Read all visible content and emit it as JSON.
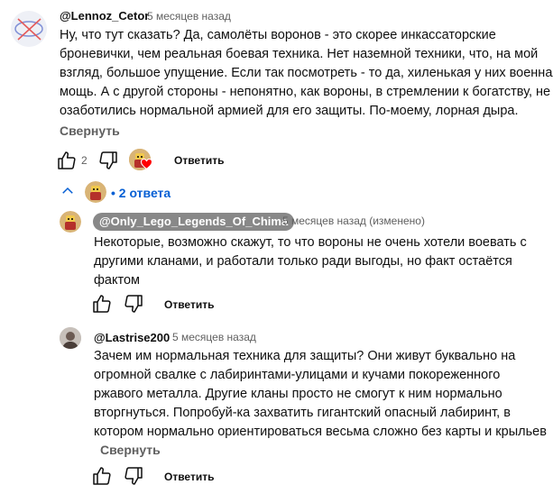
{
  "comments": [
    {
      "author": "@Lennoz_Cetor",
      "time": "5 месяцев назад",
      "lines": [
        "Ну, что тут сказать? Да, самолёты воронов - это скорее инкассаторские",
        "броневички, чем реальная боевая техника. Нет наземной техники, что, на мой",
        "взгляд, большое упущение. Если так посмотреть - то да, хиленькая у них военная",
        "мощь. А с другой стороны - непонятно, как вороны, в стремлении к богатству, не",
        "озаботились нормальной армией для его защиты. По-моему, лорная дыра."
      ],
      "collapse_label": "Свернуть",
      "like_count": "2",
      "reply_label": "Ответить",
      "replies_toggle": "• 2 ответа"
    }
  ],
  "replies": [
    {
      "author": "@Only_Lego_Legends_Of_Chima",
      "time": "5 месяцев назад (изменено)",
      "lines": [
        "Некоторые, возможно скажут, то что вороны не очень хотели воевать с",
        "другими кланами, и работали только ради выгоды, но факт остаётся",
        "фактом"
      ],
      "reply_label": "Ответить"
    },
    {
      "author": "@Lastrise200",
      "time": "5 месяцев назад",
      "lines": [
        "Зачем им нормальная техника для защиты? Они живут буквально на",
        "огромной свалке с лабиринтами-улицами и кучами покореженного",
        "ржавого металла. Другие кланы просто не смогут к ним нормально",
        "вторгнуться. Попробуй-ка захватить гигантский опасный лабиринт, в",
        "котором нормально ориентироваться весьма сложно без карты и крыльев"
      ],
      "collapse_label": "Свернуть",
      "reply_label": "Ответить"
    }
  ],
  "colors": {
    "link_blue": "#065fd4",
    "secondary_text": "#606060",
    "heart_red": "#ff0000"
  }
}
